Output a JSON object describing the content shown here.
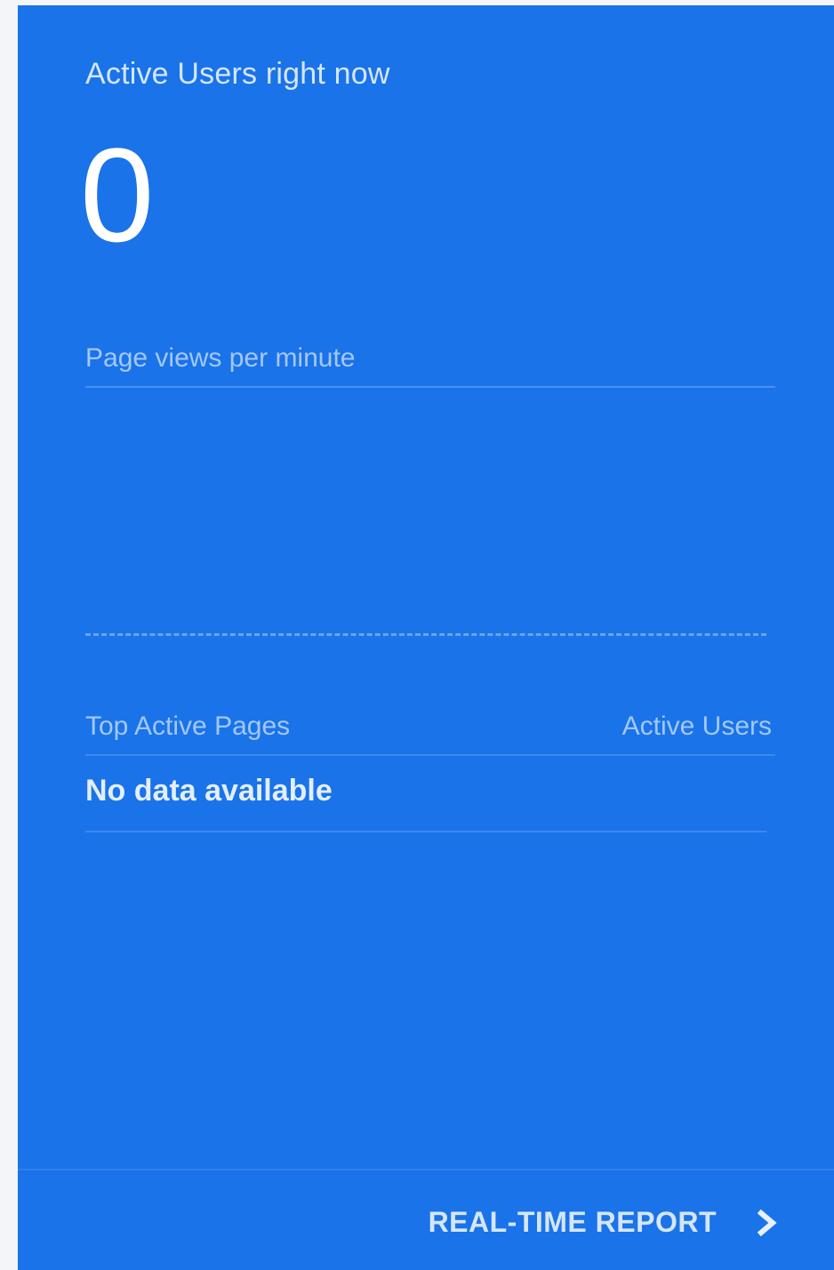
{
  "card": {
    "title": "Active Users right now",
    "active_users_count": "0",
    "pageviews_label": "Page views per minute",
    "table": {
      "col_left": "Top Active Pages",
      "col_right": "Active Users",
      "empty_message": "No data available"
    },
    "footer": {
      "link_label": "REAL-TIME REPORT",
      "link_icon": "chevron-right-icon"
    }
  },
  "colors": {
    "card_background": "#1a73e8",
    "page_background": "#f3f5f8",
    "text": "#ffffff"
  }
}
